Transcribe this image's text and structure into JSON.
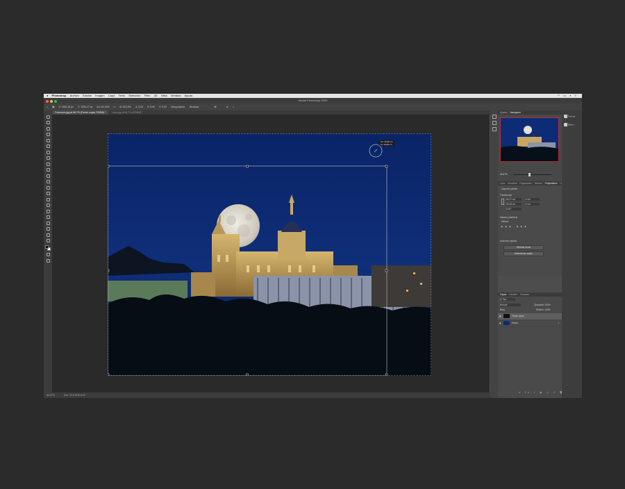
{
  "menubar": {
    "app": "Photoshop",
    "items": [
      "Archivo",
      "Edición",
      "Imagen",
      "Capa",
      "Texto",
      "Selección",
      "Filtro",
      "3D",
      "Vista",
      "Ventana",
      "Ayuda"
    ]
  },
  "window": {
    "title": "Adobe Photoshop 2020"
  },
  "options_bar": {
    "x": "X: 1661,25 px",
    "y": "Y: 1093,17 px",
    "w": "An: 80,15%",
    "h": "Al: 80,15%",
    "angle": "∡ 0,00",
    "h_skew": "H: 0,00",
    "v_skew": "V: 0,00",
    "interp_label": "Interpolación:",
    "interp_value": "Bicúbica"
  },
  "tabs": [
    {
      "label": "Fotomoon.jpg al 66,7% (Fondo copia, RGB/8) *",
      "active": true
    },
    {
      "label": "Luna.jpg al 66,7% (RGB/8) *",
      "active": false
    }
  ],
  "canvas": {
    "tooltip_line1": "An: 20,08 cm",
    "tooltip_line2": "Al: 20,08 cm"
  },
  "status": {
    "zoom": "66,67%",
    "doc": "Doc: 30,6 M/30,6 M"
  },
  "navigator": {
    "tabs": [
      "Ajustes",
      "Navegador"
    ],
    "zoom": "66,67%"
  },
  "properties": {
    "tabs": [
      "Color",
      "Muestras",
      "Degradados",
      "Motivos",
      "Propiedades",
      "Historia"
    ],
    "layer_type": "Capa de píxeles",
    "transform_label": "Transformar",
    "w_value": "50,27 cm",
    "x_value": "0 cm",
    "h_value": "26,08 cm",
    "y_value": "0 cm",
    "angle_value": "0,00°",
    "align_label": "Alinear y distribuir",
    "align_sub": "Alinear:",
    "quick_label": "Acciones rápidas",
    "quick_btn1": "Eliminar fondo",
    "quick_btn2": "Seleccionar sujeto"
  },
  "layers": {
    "tabs": [
      "Capas",
      "Canales",
      "Trazados"
    ],
    "filter": "Q Tipo",
    "blend": "Normal",
    "opacity": "Opacidad: 100%",
    "lock": "Bloq:",
    "fill": "Relleno: 100%",
    "items": [
      {
        "name": "Fondo copia",
        "selected": true
      },
      {
        "name": "Fondo",
        "selected": false
      }
    ]
  },
  "dock": {
    "item1": "Formas",
    "item2": "Bibliot..."
  },
  "colors": {
    "sky": "#0c2a6e",
    "moon": "#d8d4cb",
    "ps_panel": "#4d4d4d"
  }
}
